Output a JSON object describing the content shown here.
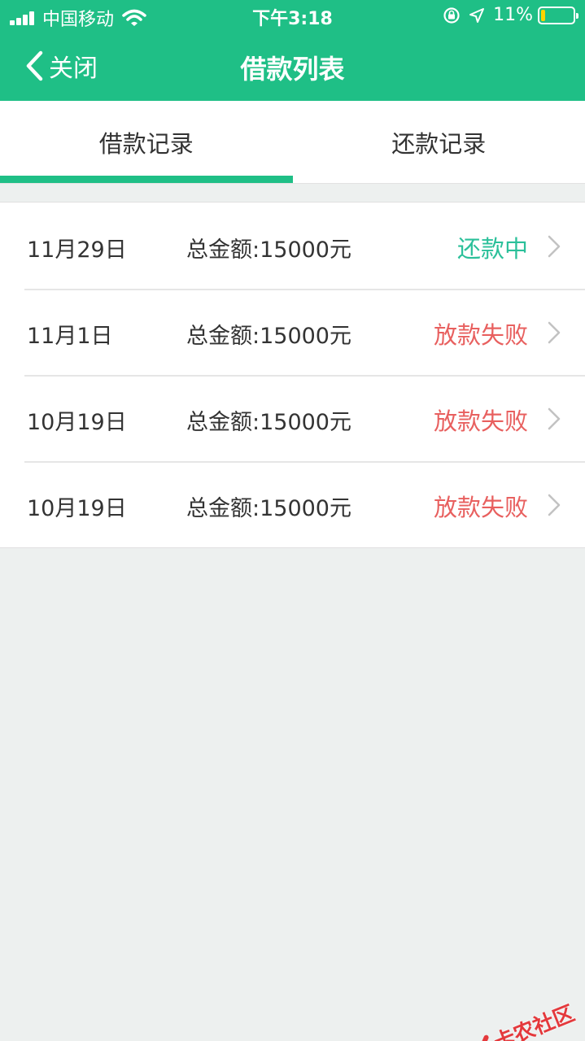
{
  "status_bar": {
    "carrier": "中国移动",
    "time": "下午3:18",
    "battery_percent": "11%",
    "battery_level": 0.11,
    "icons": [
      "signal-icon",
      "wifi-icon",
      "rotation-lock-icon",
      "location-arrow-icon",
      "battery-icon"
    ]
  },
  "navbar": {
    "back_label": "关闭",
    "title": "借款列表"
  },
  "tabs": [
    {
      "label": "借款记录",
      "active": true
    },
    {
      "label": "还款记录",
      "active": false
    }
  ],
  "records": [
    {
      "date": "11月29日",
      "amount": "总金额:15000元",
      "status": "还款中",
      "status_color": "#2bc09a"
    },
    {
      "date": "11月1日",
      "amount": "总金额:15000元",
      "status": "放款失败",
      "status_color": "#e8605f"
    },
    {
      "date": "10月19日",
      "amount": "总金额:15000元",
      "status": "放款失败",
      "status_color": "#e8605f"
    },
    {
      "date": "10月19日",
      "amount": "总金额:15000元",
      "status": "放款失败",
      "status_color": "#e8605f"
    }
  ],
  "watermark": {
    "text": "卡农社区"
  },
  "colors": {
    "brand": "#1fbf86",
    "background": "#edf0ef",
    "chevron": "#c2c2c2"
  }
}
